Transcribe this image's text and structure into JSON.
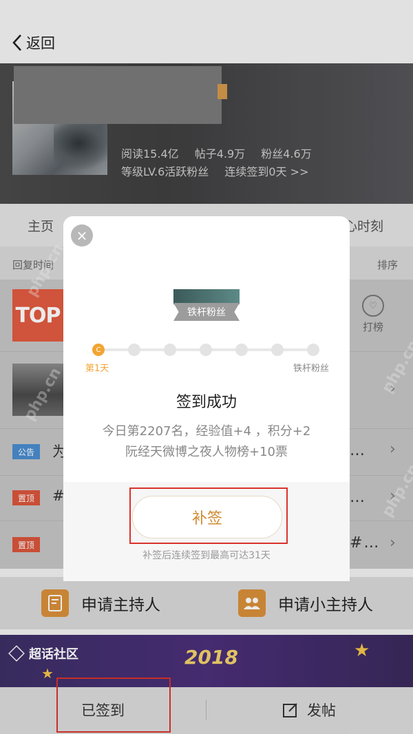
{
  "topbar": {
    "back_label": "返回"
  },
  "header": {
    "stats_line1": [
      "阅读15.4亿",
      "帖子4.9万",
      "粉丝4.6万"
    ],
    "level_text": "等级LV.6活跃粉丝",
    "checkin_text": "连续签到0天 >>"
  },
  "tabs": [
    {
      "label": "主页"
    },
    {
      "label": "心时刻"
    }
  ],
  "sort": {
    "left": "回复时间",
    "right": "排序"
  },
  "list": {
    "thumb_top_text": "TOP",
    "rank_button": "打榜",
    "rows": [
      {
        "tag": "公告",
        "text": "为",
        "type": "notice"
      },
      {
        "tag": "置顶",
        "text": "#",
        "type": "pin"
      },
      {
        "tag": "置顶",
        "text": "",
        "type": "pin",
        "tail": "#…"
      }
    ]
  },
  "apply": {
    "host": "申请主持人",
    "sub_host": "申请小主持人"
  },
  "promo": {
    "brand": "超话社区",
    "year": "2018"
  },
  "bottom": {
    "checked_in": "已签到",
    "post": "发帖"
  },
  "modal": {
    "badge_name": "铁杆粉丝",
    "progress_start": "第1天",
    "progress_end": "铁杆粉丝",
    "progress_day": "C",
    "title": "签到成功",
    "line1": "今日第2207名，经验值+4 ，积分+2",
    "line2": "阮经天微博之夜人物榜+10票",
    "makeup_button": "补签",
    "makeup_note": "补签后连续签到最高可达31天",
    "close_symbol": "×"
  },
  "watermark": "php.cn",
  "colors": {
    "accent_orange": "#d08a32",
    "highlight_red": "#d9322c",
    "progress_active": "#f2a533"
  }
}
